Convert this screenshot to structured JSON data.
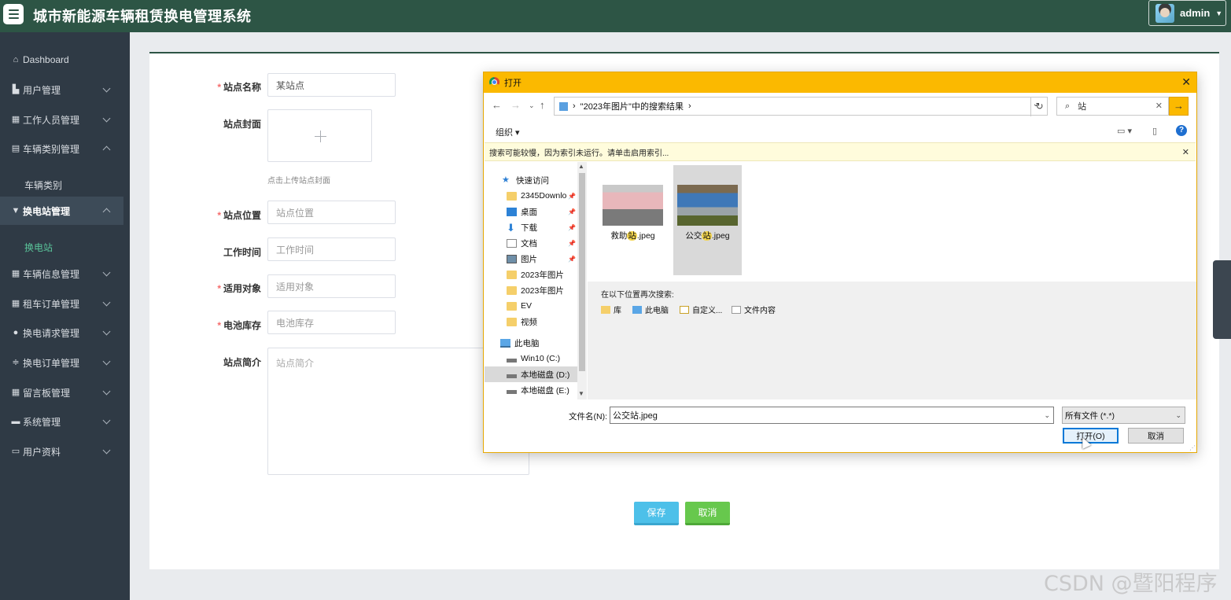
{
  "header": {
    "title": "城市新能源车辆租赁换电管理系统",
    "user": "admin"
  },
  "sidebar": {
    "dashboard": "Dashboard",
    "items": [
      {
        "label": "用户管理"
      },
      {
        "label": "工作人员管理"
      },
      {
        "label": "车辆类别管理"
      },
      {
        "label": "换电站管理"
      },
      {
        "label": "车辆信息管理"
      },
      {
        "label": "租车订单管理"
      },
      {
        "label": "换电请求管理"
      },
      {
        "label": "换电订单管理"
      },
      {
        "label": "留言板管理"
      },
      {
        "label": "系统管理"
      },
      {
        "label": "用户资料"
      }
    ],
    "sub_vehicle_category": "车辆类别",
    "sub_station": "换电站"
  },
  "form": {
    "name_label": "站点名称",
    "name_value": "某站点",
    "cover_label": "站点封面",
    "cover_hint": "点击上传站点封面",
    "location_label": "站点位置",
    "location_placeholder": "站点位置",
    "hours_label": "工作时间",
    "hours_placeholder": "工作时间",
    "target_label": "适用对象",
    "target_placeholder": "适用对象",
    "battery_label": "电池库存",
    "battery_placeholder": "电池库存",
    "intro_label": "站点简介",
    "intro_placeholder": "站点简介",
    "required_mark": "*",
    "save": "保存",
    "cancel": "取消"
  },
  "dialog": {
    "title": "打开",
    "address_chevron": "›",
    "address": "\"2023年图片\"中的搜索结果",
    "search_value": "站",
    "organize": "组织 ▾",
    "info": "搜索可能较慢，因为索引未运行。请单击启用索引...",
    "tree": [
      {
        "label": "快速访问"
      },
      {
        "label": "2345Downlo"
      },
      {
        "label": "桌面"
      },
      {
        "label": "下载"
      },
      {
        "label": "文档"
      },
      {
        "label": "图片"
      },
      {
        "label": "2023年图片"
      },
      {
        "label": "2023年图片"
      },
      {
        "label": "EV"
      },
      {
        "label": "视频"
      },
      {
        "label": "此电脑"
      },
      {
        "label": "Win10 (C:)"
      },
      {
        "label": "本地磁盘 (D:)"
      },
      {
        "label": "本地磁盘 (E:)"
      }
    ],
    "files": [
      {
        "prefix": "救助",
        "highlight": "站",
        "suffix": ".jpeg"
      },
      {
        "prefix": "公交",
        "highlight": "站",
        "suffix": ".jpeg"
      }
    ],
    "search_again_label": "在以下位置再次搜索:",
    "search_again": [
      "库",
      "此电脑",
      "自定义...",
      "文件内容"
    ],
    "filename_label": "文件名(N):",
    "filename_value": "公交站.jpeg",
    "filetype": "所有文件 (*.*)",
    "open_button": "打开(O)",
    "cancel_button": "取消"
  },
  "watermark": "CSDN @暨阳程序"
}
